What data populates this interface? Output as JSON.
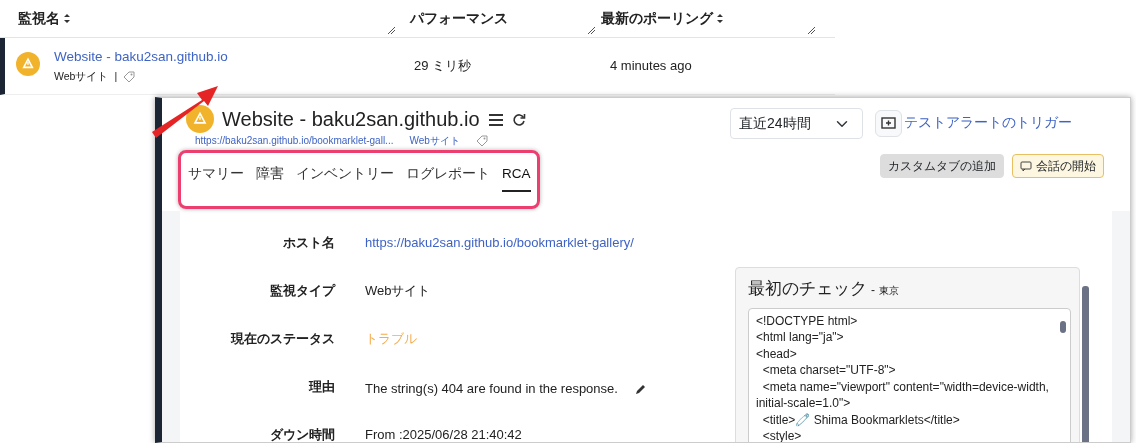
{
  "table": {
    "columns": [
      {
        "label": "監視名",
        "sortable": true
      },
      {
        "label": "パフォーマンス"
      },
      {
        "label": "最新のポーリング",
        "sortable": true
      }
    ],
    "rows": [
      {
        "name": "Website - baku2san.github.io",
        "type": "Webサイト",
        "separator": "|",
        "performance": "29 ミリ秒",
        "last_poll": "4 minutes ago",
        "warning": true
      }
    ]
  },
  "detail": {
    "title": "Website - baku2san.github.io",
    "warning": true,
    "url": "https://baku2san.github.io/bookmarklet-gall...",
    "type": "Webサイト",
    "period": "直近24時間",
    "trigger": "テストアラートのトリガー",
    "tabs": [
      {
        "label": "サマリー",
        "selected": false
      },
      {
        "label": "障害",
        "selected": false
      },
      {
        "label": "インベントリー",
        "selected": false
      },
      {
        "label": "ログレポート",
        "selected": false
      },
      {
        "label": "RCA",
        "selected": true
      }
    ],
    "buttons": [
      {
        "label": "カスタムタブの追加",
        "kind": "plain"
      },
      {
        "label": "会話の開始",
        "kind": "chat"
      }
    ],
    "fields": [
      {
        "label": "ホスト名",
        "value": "https://baku2san.github.io/bookmarklet-gallery/",
        "kind": "link"
      },
      {
        "label": "監視タイプ",
        "value": "Webサイト",
        "kind": "text"
      },
      {
        "label": "現在のステータス",
        "value": "トラブル",
        "kind": "status"
      },
      {
        "label": "理由",
        "value": "The string(s) 404 are found in the response.",
        "kind": "editable"
      },
      {
        "label": "ダウン時間",
        "value": "From :2025/06/28 21:40:42",
        "kind": "text"
      }
    ],
    "first_check": {
      "title": "最初のチェック",
      "separator": "-",
      "location": "東京",
      "lines": [
        "<!DOCTYPE html>",
        "<html lang=\"ja\">",
        "<head>",
        "  <meta charset=\"UTF-8\">",
        "  <meta name=\"viewport\" content=\"width=device-width, initial-scale=1.0\">",
        "  <title>🧷 Shima Bookmarklets</title>",
        "  <style>"
      ]
    }
  }
}
